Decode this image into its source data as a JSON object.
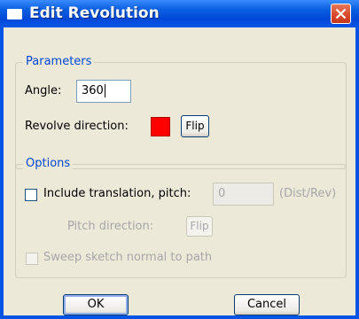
{
  "window": {
    "title": "Edit Revolution",
    "icon": "window-icon",
    "close_icon": "close-icon"
  },
  "parameters": {
    "legend": "Parameters",
    "angle_label": "Angle:",
    "angle_value": "360",
    "revolve_direction_label": "Revolve direction:",
    "revolve_color": "#ff0000",
    "flip_label": "Flip"
  },
  "options": {
    "legend": "Options",
    "include_translation_label": "Include translation, pitch:",
    "pitch_value": "0",
    "pitch_unit": "(Dist/Rev)",
    "pitch_direction_label": "Pitch direction:",
    "pitch_flip_label": "Flip",
    "sweep_label": "Sweep sketch normal to path"
  },
  "buttons": {
    "ok": "OK",
    "cancel": "Cancel"
  }
}
